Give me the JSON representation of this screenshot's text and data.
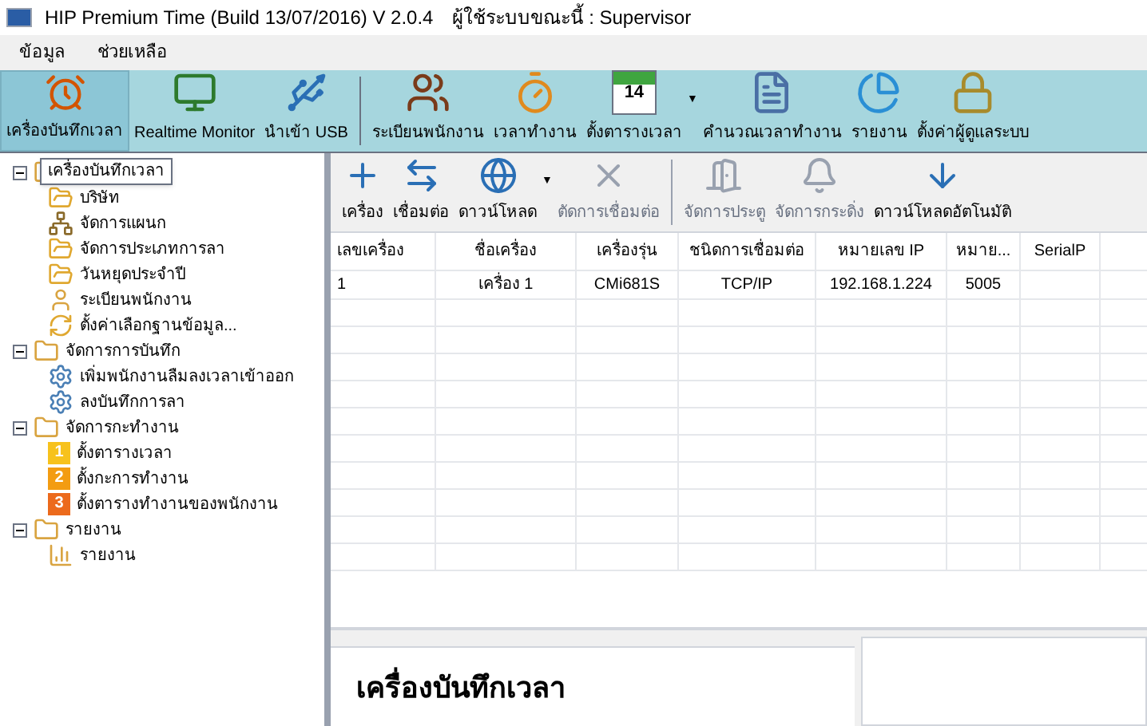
{
  "window": {
    "title": "HIP Premium Time (Build 13/07/2016) V 2.0.4",
    "user_label": "ผู้ใช้ระบบขณะนี้ : Supervisor"
  },
  "menu": [
    "ข้อมูล",
    "ช่วยเหลือ"
  ],
  "toolbar_groups": [
    [
      {
        "label": "เครื่องบันทึกเวลา",
        "selected": true
      },
      {
        "label": "Realtime Monitor",
        "selected": false
      },
      {
        "label": "นำเข้า USB",
        "selected": false
      }
    ],
    [
      {
        "label": "ระเบียนพนักงาน",
        "selected": false
      },
      {
        "label": "เวลาทำงาน",
        "selected": false
      },
      {
        "label": "ตั้งตารางเวลา",
        "selected": false,
        "calendar_number": "14",
        "dropdown_caret": "▼"
      },
      {
        "label": "คำนวณเวลาทำงาน",
        "selected": false
      },
      {
        "label": "รายงาน",
        "selected": false
      },
      {
        "label": "ตั้งค่าผู้ดูแลระบบ",
        "selected": false
      }
    ]
  ],
  "tree": [
    {
      "tooltip": "เครื่องบันทึกเวลา",
      "expanded": true,
      "children": [
        {
          "label": "บริษัท",
          "kind": "folder"
        },
        {
          "label": "จัดการแผนก",
          "kind": "org"
        },
        {
          "label": "จัดการประเภทการลา",
          "kind": "folder"
        },
        {
          "label": "วันหยุดประจำปี",
          "kind": "folder"
        },
        {
          "label": "ระเบียนพนักงาน",
          "kind": "person"
        },
        {
          "label": "ตั้งค่าเลือกฐานข้อมูล...",
          "kind": "refresh"
        }
      ]
    },
    {
      "label": "จัดการการบันทึก",
      "expanded": true,
      "children": [
        {
          "label": "เพิ่มพนักงานลืมลงเวลาเข้าออก",
          "kind": "gear"
        },
        {
          "label": "ลงบันทึกการลา",
          "kind": "gear"
        }
      ]
    },
    {
      "label": "จัดการกะทำงาน",
      "expanded": true,
      "children": [
        {
          "label": "ตั้งตารางเวลา",
          "kind": "badge",
          "badge": "1",
          "color": "#f7c21d"
        },
        {
          "label": "ตั้งกะการทำงาน",
          "kind": "badge",
          "badge": "2",
          "color": "#f39c12"
        },
        {
          "label": "ตั้งตารางทำงานของพนักงาน",
          "kind": "badge",
          "badge": "3",
          "color": "#ec6a1c"
        }
      ]
    },
    {
      "label": "รายงาน",
      "expanded": true,
      "children": [
        {
          "label": "รายงาน",
          "kind": "chart"
        }
      ]
    }
  ],
  "device_toolbar_groups": [
    [
      {
        "label": "เครื่อง",
        "disabled": false
      },
      {
        "label": "เชื่อมต่อ",
        "disabled": false
      },
      {
        "label": "ดาวน์โหลด",
        "disabled": false,
        "dropdown_caret": "▼"
      },
      {
        "label": "ตัดการเชื่อมต่อ",
        "disabled": true
      }
    ],
    [
      {
        "label": "จัดการประตู",
        "disabled": true
      },
      {
        "label": "จัดการกระดิ่ง",
        "disabled": true
      },
      {
        "label": "ดาวน์โหลดอัตโนมัติ",
        "disabled": false
      }
    ]
  ],
  "table": {
    "columns": [
      "เลขเครื่อง",
      "ชื่อเครื่อง",
      "เครื่องรุ่น",
      "ชนิดการเชื่อมต่อ",
      "หมายเลข IP",
      "หมาย...",
      "SerialP"
    ],
    "rows": [
      [
        "1",
        "เครื่อง 1",
        "CMi681S",
        "TCP/IP",
        "192.168.1.224",
        "5005",
        ""
      ]
    ]
  },
  "detail": {
    "title": "เครื่องบันทึกเวลา"
  }
}
